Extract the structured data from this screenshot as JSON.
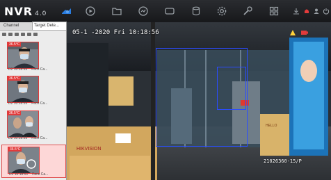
{
  "app": {
    "name": "NVR",
    "version": "4.0"
  },
  "colors": {
    "accent": "#2a7de1",
    "alert": "#e23b3b",
    "bbox": "#2a4cff"
  },
  "topbar": {
    "nav_icons": [
      "live-view-icon",
      "playback-icon",
      "files-icon",
      "smart-analysis-icon",
      "display-icon",
      "storage-icon",
      "settings-icon",
      "maintenance-icon",
      "layout-icon"
    ],
    "right_icons": [
      "download-icon",
      "alarm-icon",
      "account-icon",
      "power-icon"
    ]
  },
  "sidebar": {
    "tabs": [
      "Channel",
      "Target Dete..."
    ],
    "active_tab": 1,
    "cards": [
      {
        "temp": "36.5°C",
        "time": "D2 10:18:55",
        "type": "Face Ca..."
      },
      {
        "temp": "36.5°C",
        "time": "D2 10:18:55",
        "type": "Face Ca..."
      },
      {
        "temp": "36.5°C",
        "time": "D2 10:18:55",
        "type": "Face Ca..."
      },
      {
        "temp": "36.5°C",
        "time": "D2 10:18:51",
        "type": "Face Ca..."
      }
    ]
  },
  "video": {
    "osd_datetime": "05-1 -2020 Fri 10:18:56",
    "osd_camera": "21026360-15/P",
    "sign_text": "HELLO"
  }
}
